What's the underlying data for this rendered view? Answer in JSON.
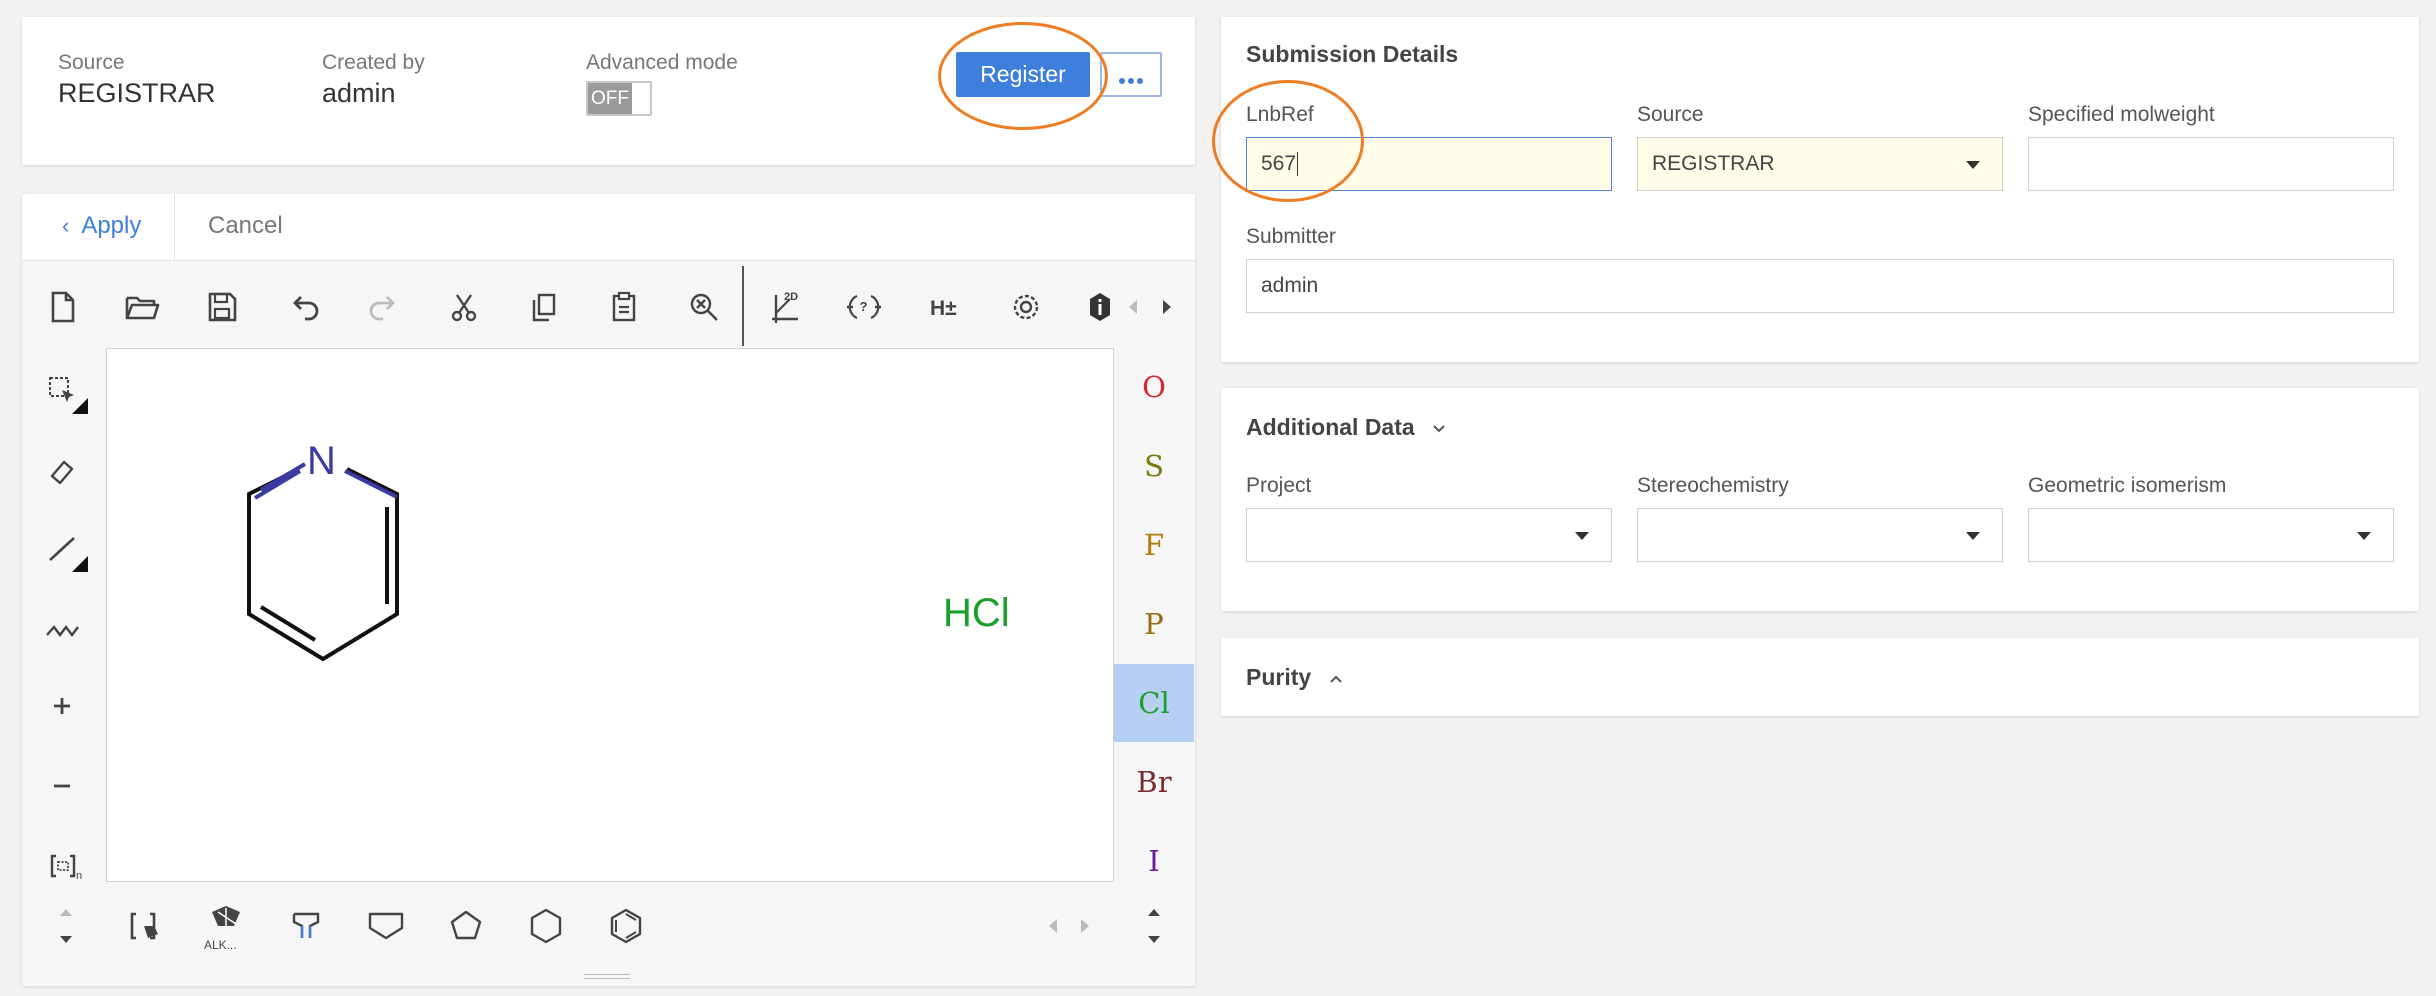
{
  "header": {
    "source_label": "Source",
    "source_value": "REGISTRAR",
    "created_by_label": "Created by",
    "created_by_value": "admin",
    "advanced_mode_label": "Advanced mode",
    "advanced_mode_toggle": "OFF",
    "register_button": "Register",
    "more_button_icon": "more-dots-icon"
  },
  "editor": {
    "apply_label": "Apply",
    "cancel_label": "Cancel",
    "top_tools": [
      "new-document-icon",
      "open-folder-icon",
      "save-icon",
      "undo-icon",
      "redo-icon",
      "cut-icon",
      "copy-icon",
      "paste-icon",
      "zoom-clear-icon",
      "clean-2d-icon",
      "query-atom-icon",
      "hydrogen-toggle-icon",
      "settings-gear-icon",
      "info-icon"
    ],
    "left_tools": [
      "select-icon",
      "eraser-icon",
      "bond-single-icon",
      "chain-icon",
      "charge-plus-icon",
      "charge-minus-icon",
      "sgroup-bracket-icon"
    ],
    "bottom_tools": [
      "template-bracket-icon",
      "alkyl-template-icon",
      "functional-group-icon",
      "cyclopropane-icon",
      "cyclobutane-icon",
      "cyclopentane-icon",
      "cyclohexane-icon"
    ],
    "alk_label": "ALK...",
    "molecule": {
      "atom_N": "N",
      "counterion": "HCl"
    },
    "atoms": [
      {
        "symbol": "O",
        "color": "#d9262c"
      },
      {
        "symbol": "S",
        "color": "#7a7a0a"
      },
      {
        "symbol": "F",
        "color": "#b07a10"
      },
      {
        "symbol": "P",
        "color": "#9a6a10"
      },
      {
        "symbol": "Cl",
        "color": "#17a02a",
        "selected": true
      },
      {
        "symbol": "Br",
        "color": "#7a2a2a"
      },
      {
        "symbol": "I",
        "color": "#6a1aa0"
      }
    ]
  },
  "submission": {
    "title": "Submission Details",
    "lnbref_label": "LnbRef",
    "lnbref_value": "567",
    "source_label": "Source",
    "source_value": "REGISTRAR",
    "molweight_label": "Specified molweight",
    "molweight_value": "",
    "submitter_label": "Submitter",
    "submitter_value": "admin"
  },
  "additional": {
    "title": "Additional Data",
    "project_label": "Project",
    "stereo_label": "Stereochemistry",
    "geometric_label": "Geometric isomerism"
  },
  "purity": {
    "title": "Purity"
  },
  "colors": {
    "accent": "#3f7fdc",
    "highlight": "#ef7c22",
    "selected_atom": "#b6cff2"
  }
}
